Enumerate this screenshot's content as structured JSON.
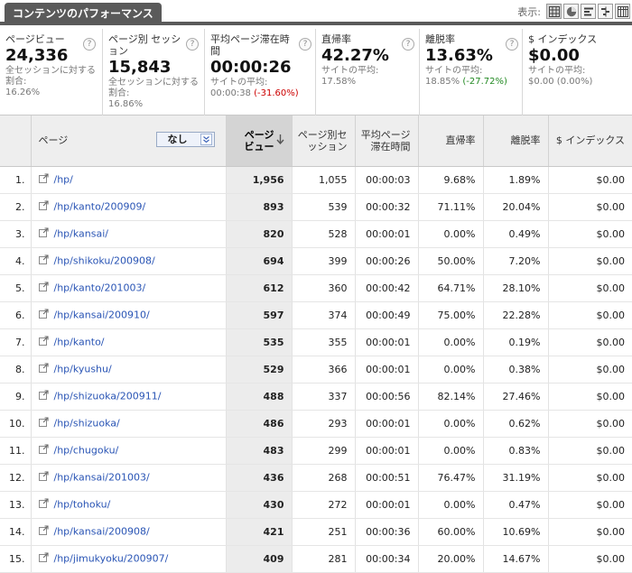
{
  "header": {
    "title": "コンテンツのパフォーマンス",
    "view_label": "表示:",
    "view_buttons": [
      "table-view-icon",
      "pie-view-icon",
      "performance-view-icon",
      "comparison-view-icon",
      "pivot-view-icon"
    ]
  },
  "summary": [
    {
      "label": "ページビュー",
      "value": "24,336",
      "sub1": "全セッションに対する割合:",
      "sub_val": "16.26%"
    },
    {
      "label": "ページ別 セッション",
      "value": "15,843",
      "sub1": "全セッションに対する割合:",
      "sub_val": "16.86%"
    },
    {
      "label": "平均ページ滞在時間",
      "value": "00:00:26",
      "sub1": "サイトの平均:",
      "sub_val": "00:00:38",
      "delta": "(-31.60%)"
    },
    {
      "label": "直帰率",
      "value": "42.27%",
      "sub1": "サイトの平均:",
      "sub_val": "17.58%"
    },
    {
      "label": "離脱率",
      "value": "13.63%",
      "sub1": "サイトの平均:",
      "sub_val": "18.85%",
      "delta": "(-27.72%)"
    },
    {
      "label": "$ インデックス",
      "value": "$0.00",
      "sub1": "サイトの平均:",
      "sub_val": "$0.00 (0.00%)"
    }
  ],
  "table": {
    "columns": {
      "page": "ページ",
      "dimension": "なし",
      "pageviews": "ページビュー",
      "sessions": "ページ別セッション",
      "avg_time": "平均ページ滞在時間",
      "bounce": "直帰率",
      "exit": "離脱率",
      "index": "$ インデックス"
    },
    "rows": [
      {
        "n": "1.",
        "page": "/hp/",
        "pv": "1,956",
        "s": "1,055",
        "t": "00:00:03",
        "b": "9.68%",
        "e": "1.89%",
        "i": "$0.00"
      },
      {
        "n": "2.",
        "page": "/hp/kanto/200909/",
        "pv": "893",
        "s": "539",
        "t": "00:00:32",
        "b": "71.11%",
        "e": "20.04%",
        "i": "$0.00"
      },
      {
        "n": "3.",
        "page": "/hp/kansai/",
        "pv": "820",
        "s": "528",
        "t": "00:00:01",
        "b": "0.00%",
        "e": "0.49%",
        "i": "$0.00"
      },
      {
        "n": "4.",
        "page": "/hp/shikoku/200908/",
        "pv": "694",
        "s": "399",
        "t": "00:00:26",
        "b": "50.00%",
        "e": "7.20%",
        "i": "$0.00"
      },
      {
        "n": "5.",
        "page": "/hp/kanto/201003/",
        "pv": "612",
        "s": "360",
        "t": "00:00:42",
        "b": "64.71%",
        "e": "28.10%",
        "i": "$0.00"
      },
      {
        "n": "6.",
        "page": "/hp/kansai/200910/",
        "pv": "597",
        "s": "374",
        "t": "00:00:49",
        "b": "75.00%",
        "e": "22.28%",
        "i": "$0.00"
      },
      {
        "n": "7.",
        "page": "/hp/kanto/",
        "pv": "535",
        "s": "355",
        "t": "00:00:01",
        "b": "0.00%",
        "e": "0.19%",
        "i": "$0.00"
      },
      {
        "n": "8.",
        "page": "/hp/kyushu/",
        "pv": "529",
        "s": "366",
        "t": "00:00:01",
        "b": "0.00%",
        "e": "0.38%",
        "i": "$0.00"
      },
      {
        "n": "9.",
        "page": "/hp/shizuoka/200911/",
        "pv": "488",
        "s": "337",
        "t": "00:00:56",
        "b": "82.14%",
        "e": "27.46%",
        "i": "$0.00"
      },
      {
        "n": "10.",
        "page": "/hp/shizuoka/",
        "pv": "486",
        "s": "293",
        "t": "00:00:01",
        "b": "0.00%",
        "e": "0.62%",
        "i": "$0.00"
      },
      {
        "n": "11.",
        "page": "/hp/chugoku/",
        "pv": "483",
        "s": "299",
        "t": "00:00:01",
        "b": "0.00%",
        "e": "0.83%",
        "i": "$0.00"
      },
      {
        "n": "12.",
        "page": "/hp/kansai/201003/",
        "pv": "436",
        "s": "268",
        "t": "00:00:51",
        "b": "76.47%",
        "e": "31.19%",
        "i": "$0.00"
      },
      {
        "n": "13.",
        "page": "/hp/tohoku/",
        "pv": "430",
        "s": "272",
        "t": "00:00:01",
        "b": "0.00%",
        "e": "0.47%",
        "i": "$0.00"
      },
      {
        "n": "14.",
        "page": "/hp/kansai/200908/",
        "pv": "421",
        "s": "251",
        "t": "00:00:36",
        "b": "60.00%",
        "e": "10.69%",
        "i": "$0.00"
      },
      {
        "n": "15.",
        "page": "/hp/jimukyoku/200907/",
        "pv": "409",
        "s": "281",
        "t": "00:00:34",
        "b": "20.00%",
        "e": "14.67%",
        "i": "$0.00"
      }
    ]
  },
  "colors": {
    "accent_dark": "#5a5a5a",
    "link": "#2a55b5",
    "negative": "#cc0000",
    "positive": "#238a23"
  }
}
